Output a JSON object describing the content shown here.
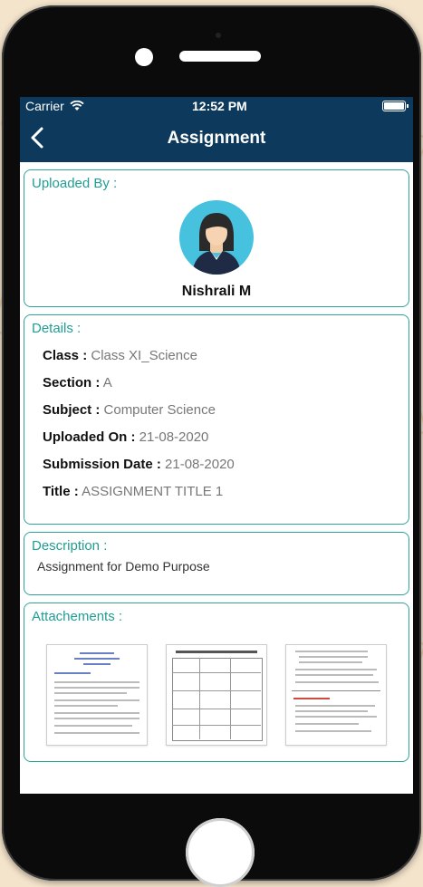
{
  "status_bar": {
    "carrier": "Carrier",
    "time": "12:52 PM"
  },
  "header": {
    "title": "Assignment"
  },
  "uploaded_by": {
    "heading": "Uploaded By :",
    "name": "Nishrali  M"
  },
  "details": {
    "heading": "Details :",
    "rows": [
      {
        "label": "Class :",
        "value": "Class XI_Science"
      },
      {
        "label": "Section :",
        "value": "A"
      },
      {
        "label": "Subject :",
        "value": "Computer Science"
      },
      {
        "label": "Uploaded On :",
        "value": "21-08-2020"
      },
      {
        "label": "Submission Date :",
        "value": "21-08-2020"
      },
      {
        "label": "Title :",
        "value": "ASSIGNMENT TITLE 1"
      }
    ]
  },
  "description": {
    "heading": "Description :",
    "text": "Assignment for Demo Purpose"
  },
  "attachments": {
    "heading": "Attachements :",
    "items": [
      "document-thumbnail",
      "table-document-thumbnail",
      "notes-document-thumbnail"
    ]
  },
  "colors": {
    "navbar": "#0d3a5c",
    "accent": "#1f9e94",
    "avatar_bg": "#46c1de"
  }
}
